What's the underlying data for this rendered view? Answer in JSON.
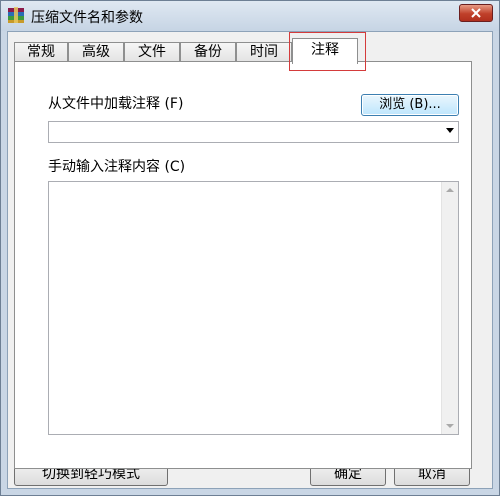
{
  "window": {
    "title": "压缩文件名和参数"
  },
  "tabs": [
    {
      "label": "常规"
    },
    {
      "label": "高级"
    },
    {
      "label": "文件"
    },
    {
      "label": "备份"
    },
    {
      "label": "时间"
    },
    {
      "label": "注释"
    }
  ],
  "active_tab": "注释",
  "comment": {
    "load_label": "从文件中加载注释 (F)",
    "browse_label": "浏览 (B)...",
    "file_value": "",
    "manual_label": "手动输入注释内容 (C)",
    "manual_value": ""
  },
  "footer": {
    "switch_label": "切换到轻巧模式",
    "ok_label": "确定",
    "cancel_label": "取消"
  }
}
